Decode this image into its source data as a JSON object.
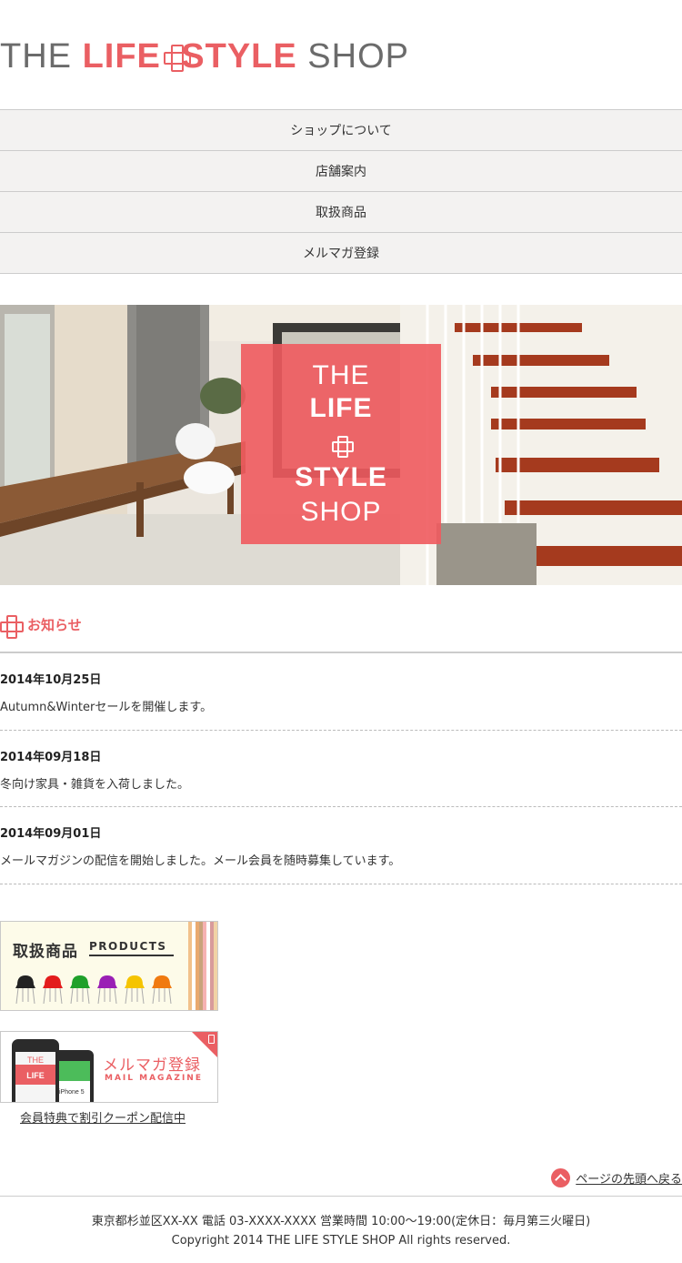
{
  "logo": {
    "the": "THE",
    "life": "LIFE",
    "style": "STYLE",
    "shop": "SHOP"
  },
  "nav": {
    "items": [
      {
        "label": "ショップについて"
      },
      {
        "label": "店舗案内"
      },
      {
        "label": "取扱商品"
      },
      {
        "label": "メルマガ登録"
      }
    ]
  },
  "hero": {
    "the": "THE",
    "life": "LIFE",
    "style": "STYLE",
    "shop": "SHOP"
  },
  "news": {
    "title": "お知らせ",
    "items": [
      {
        "date": "2014年10月25日",
        "text": "Autumn&Winterセールを開催します。"
      },
      {
        "date": "2014年09月18日",
        "text": "冬向け家具・雑貨を入荷しました。"
      },
      {
        "date": "2014年09月01日",
        "text": "メールマガジンの配信を開始しました。メール会員を随時募集しています。"
      }
    ]
  },
  "banners": {
    "products": {
      "title": "取扱商品",
      "subtitle": "PRODUCTS",
      "chair_colors": [
        "#222222",
        "#e31c1c",
        "#1fa02a",
        "#9a1fb5",
        "#f5c400",
        "#f07a10"
      ]
    },
    "mail": {
      "title": "メルマガ登録",
      "subtitle": "MAIL MAGAZINE",
      "phone_the": "THE",
      "phone_life": "LIFE",
      "phone_model": "iPhone 5"
    }
  },
  "coupon_link": "会員特典で割引クーポン配信中",
  "pagetop": {
    "label": "ページの先頭へ戻る"
  },
  "footer": {
    "address": "東京都杉並区XX-XX 電話 03-XXXX-XXXX 営業時間 10:00〜19:00(定休日：毎月第三火曜日)",
    "copyright": "Copyright 2014 THE LIFE STYLE SHOP All rights reserved."
  },
  "colors": {
    "accent": "#ea5f63",
    "nav_bg": "#f3f2f1",
    "divider": "#cccccc"
  }
}
